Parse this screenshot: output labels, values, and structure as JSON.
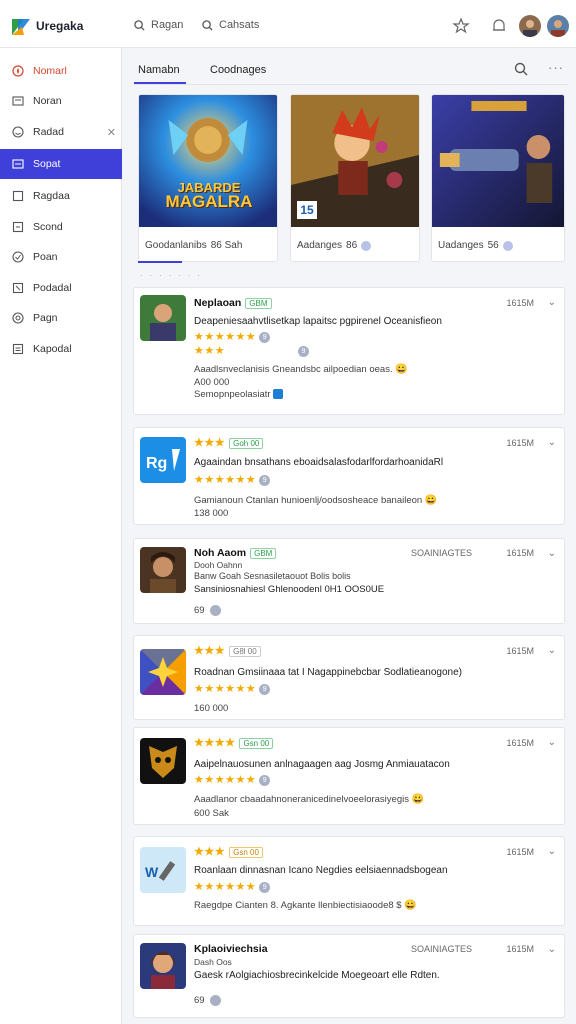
{
  "header": {
    "brand": "Uregaka",
    "search1": "Ragan",
    "search2": "Cahsats"
  },
  "sidebar": {
    "items": [
      {
        "label": "Nomarl",
        "icon": "flame-icon"
      },
      {
        "label": "Noran",
        "icon": "news-icon"
      },
      {
        "label": "Radad",
        "icon": "smile-icon"
      },
      {
        "label": "Sopat",
        "icon": "image-icon"
      },
      {
        "label": "Ragdaa",
        "icon": "doc-icon"
      },
      {
        "label": "Scond",
        "icon": "list-icon"
      },
      {
        "label": "Poan",
        "icon": "check-icon"
      },
      {
        "label": "Podadal",
        "icon": "link-icon"
      },
      {
        "label": "Pagn",
        "icon": "settings-icon"
      },
      {
        "label": "Kapodal",
        "icon": "report-icon"
      }
    ]
  },
  "tabs": [
    "Namabn",
    "Coodnages"
  ],
  "featured": [
    {
      "art_text_line1": "JABARDE",
      "art_text_line2": "MAGALRA",
      "caption": "Goodanlanibs",
      "meta": "86 Sah"
    },
    {
      "art_badge": "15",
      "caption": "Aadanges",
      "meta": "86"
    },
    {
      "caption": "Uadanges",
      "meta": "56"
    }
  ],
  "cards": [
    {
      "title": "Neplaoan",
      "badge": "GBM",
      "time": "1615M",
      "line1": "Deapeniesaahvtlisetkap lapaitsc pgpirenel Oceanisfieon",
      "rating_count": "9",
      "rating_count2": "9",
      "desc": "Aaadlsnveclanisis Gneandsbc ailpoedian oeas.",
      "desc_emoji": "😀",
      "sub": "A00 000",
      "sub2": "Semopnpeolasiatr"
    },
    {
      "title": "",
      "badge": "Goh 00",
      "time": "1615M",
      "line1": "Agaaindan bnsathans eboaidsalasfodarlfordarhoanidaRl",
      "rating_count": "9",
      "desc": "Gamianoun Ctanlan hunioenlj/oodsosheace banaileon",
      "desc_emoji": "😀",
      "sub": "138 000"
    },
    {
      "title": "Noh Aaom",
      "badge": "GBM",
      "status": "SOAINIAGTES",
      "time": "1615M",
      "sub_orange1": "Dooh Oahnn",
      "sub_orange2": "Banw Goah Sesnasiletaouot Bolis bolis",
      "line1": "Sansiniosnahiesl Ghlenoodenl 0H1 OOS0UE",
      "sub": "69"
    },
    {
      "title": "",
      "badge": "G8l 00",
      "time": "1615M",
      "line1": "Roadnan Gmsiinaaa tat I Nagappinebcbar Sodlatieanogone)",
      "rating_count": "9",
      "sub": "160 000"
    },
    {
      "title": "",
      "badge": "Gsn 00",
      "time": "1615M",
      "line1": "Aaipelnauosunen anlnagaagen aag Josmg Anmiauatacon",
      "rating_count": "9",
      "desc": "Aaadlanor cbaadahnoneranicedinelvoeelorasiyegis",
      "desc_emoji": "😀",
      "sub": "600 Sak"
    },
    {
      "title": "",
      "badge": "Gsn 00",
      "time": "1615M",
      "line1": "Roanlaan dinnasnan Icano Negdies eelsiaennadsbogean",
      "rating_count": "9",
      "desc": "Raegdpe Cianten 8. Agkante llenbiectisiaoode8 $",
      "desc_emoji": "😀"
    },
    {
      "title": "Kplaoiviechsia",
      "status": "SOAINIAGTES",
      "time": "1615M",
      "sub_orange1": "Dash Oos",
      "line1": "Gaesk rAolgiachiosbrecinkelcide Moegeoart elle Rdten.",
      "sub": "69"
    }
  ]
}
